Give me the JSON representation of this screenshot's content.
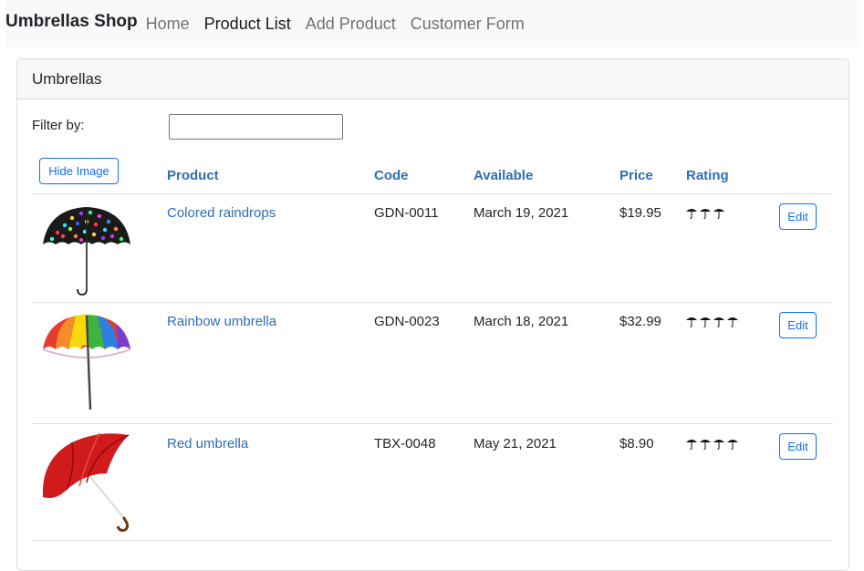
{
  "navbar": {
    "brand": "Umbrellas Shop",
    "links": [
      "Home",
      "Product List",
      "Add Product",
      "Customer Form"
    ]
  },
  "card": {
    "title": "Umbrellas",
    "filter_label": "Filter by:",
    "filter_value": "",
    "hide_image_label": "Hide Image"
  },
  "table": {
    "headers": [
      "Product",
      "Code",
      "Available",
      "Price",
      "Rating"
    ],
    "rows": [
      {
        "name": "Colored raindrops",
        "code": "GDN-0011",
        "available": "March 19, 2021",
        "price": "$19.95",
        "rating": 3,
        "image": "colored-raindrops-umbrella",
        "edit": "Edit"
      },
      {
        "name": "Rainbow umbrella",
        "code": "GDN-0023",
        "available": "March 18, 2021",
        "price": "$32.99",
        "rating": 4,
        "image": "rainbow-umbrella",
        "edit": "Edit"
      },
      {
        "name": "Red umbrella",
        "code": "TBX-0048",
        "available": "May 21, 2021",
        "price": "$8.90",
        "rating": 4,
        "image": "red-umbrella",
        "edit": "Edit"
      }
    ]
  },
  "colors": {
    "link": "#2f6db5",
    "button": "#0d6efd",
    "navbar_bg": "#f8f9fa"
  }
}
